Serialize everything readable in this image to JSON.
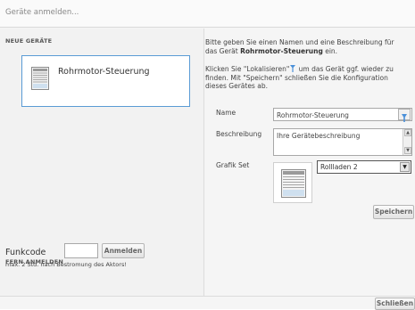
{
  "window": {
    "title": "Geräte anmelden..."
  },
  "left": {
    "new_devices_heading": "NEUE GERÄTE",
    "device": {
      "label": "Rohrmotor-Steuerung",
      "icon": "roller-shutter-icon"
    },
    "remote_heading": "FERN ANMELDEN",
    "remote_label": "Funkcode",
    "remote_input_value": "",
    "register_button": "Anmelden",
    "note": "max. 2 Std. nach Bestromung des Aktors!"
  },
  "right": {
    "instr1_a": "Bitte geben Sie einen Namen und eine Beschreibung für das Gerät ",
    "instr1_device": "Rohrmotor-Steuerung",
    "instr1_b": " ein.",
    "instr2_a": "Klicken Sie \"Lokalisieren\"",
    "instr2_b": " um das Gerät ggf. wieder zu finden. Mit \"Speichern\" schließen Sie die Konfiguration dieses Gerätes ab.",
    "name_label": "Name",
    "name_value": "Rohrmotor-Steuerung",
    "description_label": "Beschreibung",
    "description_value": "Ihre Gerätebeschreibung",
    "graphic_label": "Grafik Set",
    "graphic_selected": "Rollladen 2",
    "save_button": "Speichern"
  },
  "footer": {
    "close_button": "Schließen"
  },
  "colors": {
    "accent_border": "#5a9bd5",
    "locate_icon": "#4a90d9"
  }
}
